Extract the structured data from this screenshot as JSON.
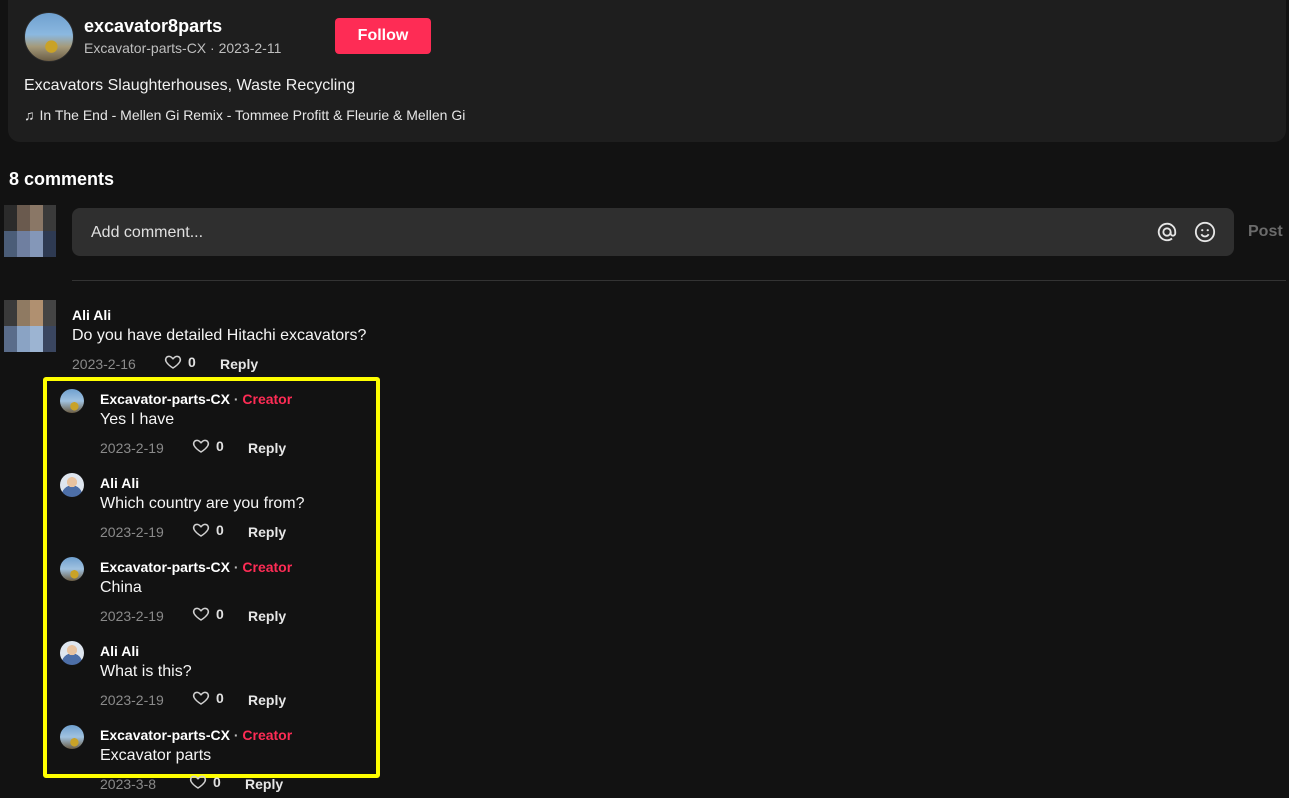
{
  "post": {
    "username": "excavator8parts",
    "subline": "Excavator-parts-CX · 2023-2-11",
    "follow_label": "Follow",
    "description": "Excavators Slaughterhouses, Waste Recycling",
    "music": "In The End - Mellen Gi Remix - Tommee Profitt & Fleurie & Mellen Gi",
    "music_icon": "♫"
  },
  "comments_header": "8 comments",
  "composer": {
    "placeholder": "Add comment...",
    "post_label": "Post"
  },
  "top_comment": {
    "author": "Ali Ali",
    "text": "Do you have detailed Hitachi excavators?",
    "date": "2023-2-16",
    "likes": "0",
    "reply_label": "Reply"
  },
  "replies": [
    {
      "author": "Excavator-parts-CX",
      "separator": " · ",
      "badge": "Creator",
      "text": "Yes I have",
      "date": "2023-2-19",
      "likes": "0",
      "reply_label": "Reply"
    },
    {
      "author": "Ali Ali",
      "separator": "",
      "badge": "",
      "text": "Which country are you from?",
      "date": "2023-2-19",
      "likes": "0",
      "reply_label": "Reply"
    },
    {
      "author": "Excavator-parts-CX",
      "separator": " · ",
      "badge": "Creator",
      "text": "China",
      "date": "2023-2-19",
      "likes": "0",
      "reply_label": "Reply"
    },
    {
      "author": "Ali Ali",
      "separator": "",
      "badge": "",
      "text": "What is this?",
      "date": "2023-2-19",
      "likes": "0",
      "reply_label": "Reply"
    },
    {
      "author": "Excavator-parts-CX",
      "separator": " · ",
      "badge": "Creator",
      "text": "Excavator parts",
      "date": "2023-3-8",
      "likes": "0",
      "reply_label": "Reply"
    }
  ],
  "colors": {
    "accent": "#fe2c55",
    "highlight": "#ffff00",
    "background": "#121212"
  }
}
